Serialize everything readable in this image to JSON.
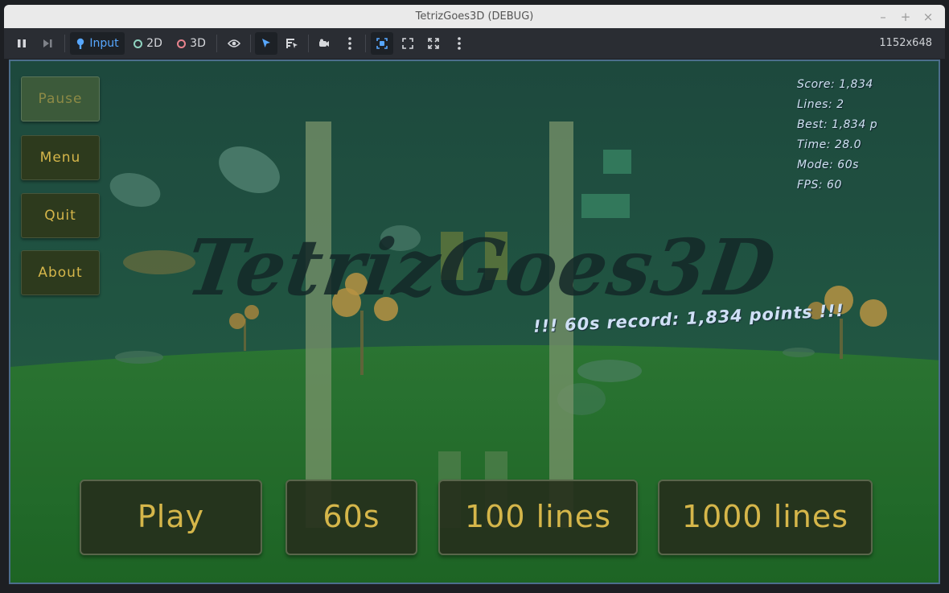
{
  "window": {
    "title": "TetrizGoes3D (DEBUG)",
    "controls": {
      "minimize": "–",
      "maximize": "+",
      "close": "×"
    }
  },
  "toolbar": {
    "input_label": "Input",
    "label_2d": "2D",
    "label_3d": "3D",
    "resolution": "1152x648",
    "colors": {
      "ring_2d": "#8fd3c0",
      "ring_3d": "#e8838d",
      "accent": "#57a7ff"
    }
  },
  "game": {
    "side_menu": {
      "pause": "Pause",
      "menu": "Menu",
      "quit": "Quit",
      "about": "About"
    },
    "stats": {
      "score": "Score: 1,834",
      "lines": "Lines: 2",
      "best": "Best: 1,834 p",
      "time": "Time: 28.0",
      "mode": "Mode: 60s",
      "fps": "FPS: 60"
    },
    "logo": "TetrizGoes3D",
    "record": "!!! 60s record: 1,834 points !!!",
    "modes": {
      "play": "Play",
      "sixty": "60s",
      "hundred": "100 lines",
      "thousand": "1000 lines"
    },
    "colors": {
      "button_text": "#d5b64a",
      "sky": "#1e4c3e",
      "ground": "#2c7a2c"
    }
  }
}
